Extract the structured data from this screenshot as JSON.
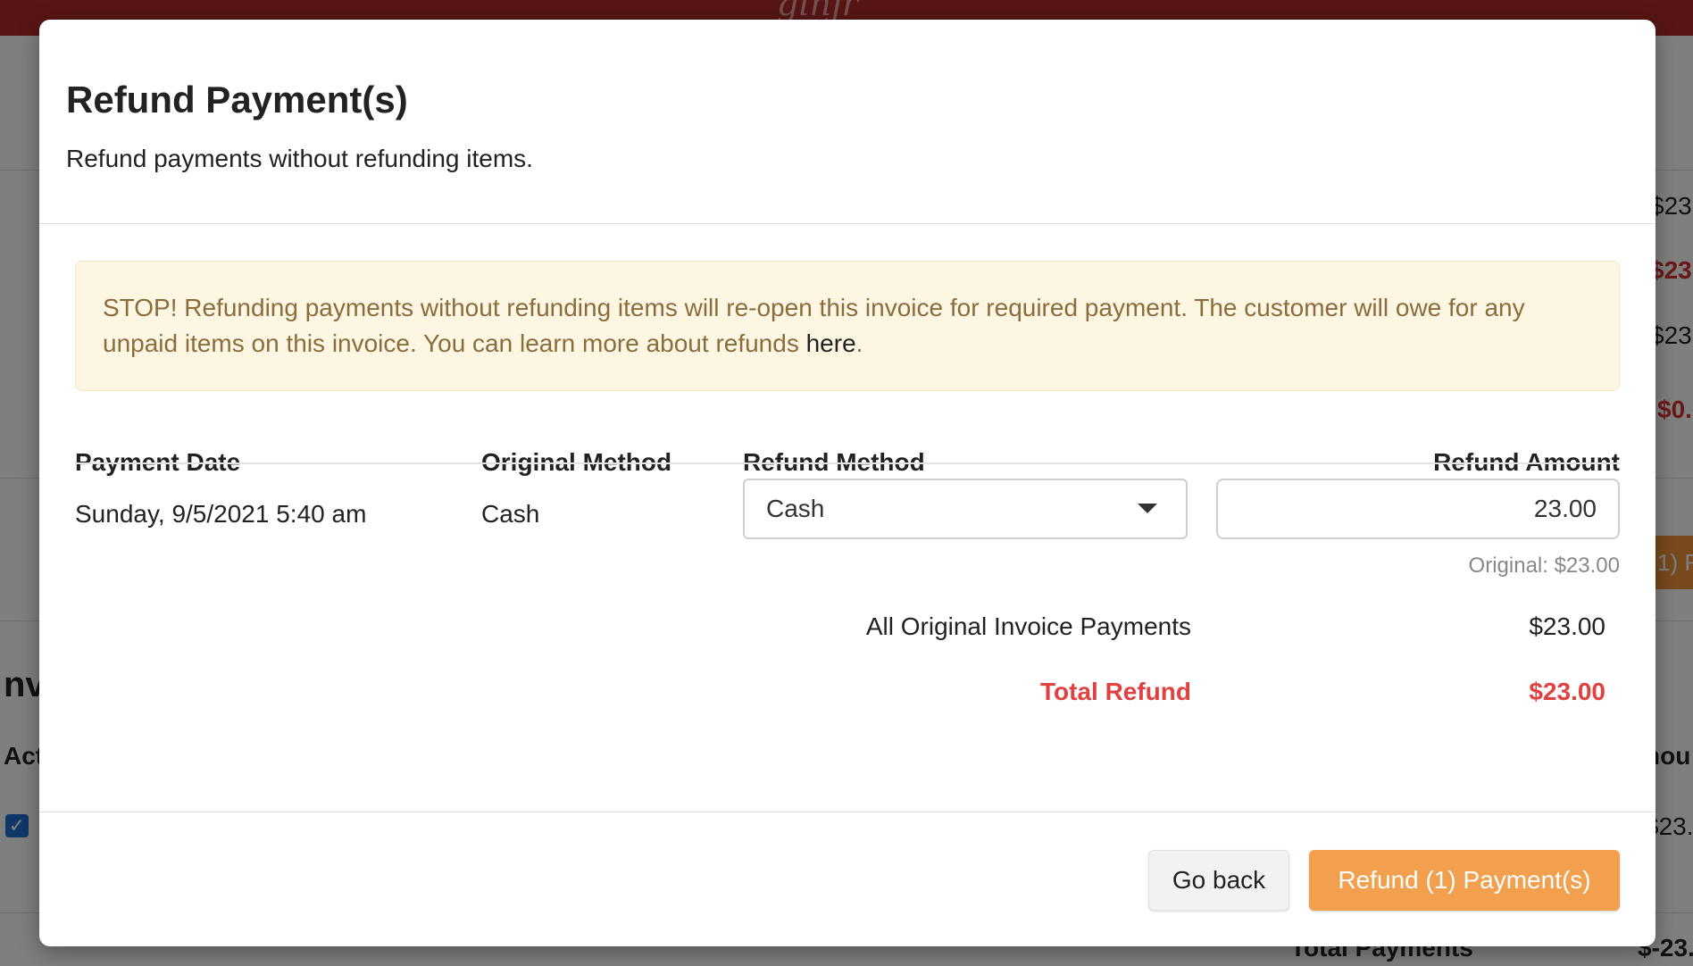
{
  "background": {
    "logo_text": "ginjr",
    "right_values": [
      "$23.",
      "$23.",
      "$23.",
      "$0.",
      "$23.",
      "$-23."
    ],
    "button_partial": "1) F",
    "section_partial": "nv",
    "col_partial_left": "Act",
    "col_partial_right": "nou",
    "total_payments_label": "Total Payments"
  },
  "modal": {
    "title": "Refund Payment(s)",
    "subtitle": "Refund payments without refunding items.",
    "alert": {
      "text": "STOP! Refunding payments without refunding items will re-open this invoice for required payment. The customer will owe for any unpaid items on this invoice. You can learn more about refunds ",
      "link_text": "here",
      "suffix": "."
    },
    "table": {
      "headers": {
        "payment_date": "Payment Date",
        "original_method": "Original Method",
        "refund_method": "Refund Method",
        "refund_amount": "Refund Amount"
      },
      "rows": [
        {
          "payment_date": "Sunday, 9/5/2021 5:40 am",
          "original_method": "Cash",
          "refund_method": "Cash",
          "refund_amount": "23.00",
          "original_note": "Original: $23.00"
        }
      ]
    },
    "summary": {
      "all_payments_label": "All Original Invoice Payments",
      "all_payments_value": "$23.00",
      "total_refund_label": "Total Refund",
      "total_refund_value": "$23.00"
    },
    "buttons": {
      "go_back": "Go back",
      "refund": "Refund (1) Payment(s)"
    }
  },
  "colors": {
    "header_red": "#b02a2a",
    "alert_bg": "#fdf6e3",
    "alert_text": "#8a6d3b",
    "total_red": "#e04141",
    "primary_orange": "#f2a04e"
  }
}
